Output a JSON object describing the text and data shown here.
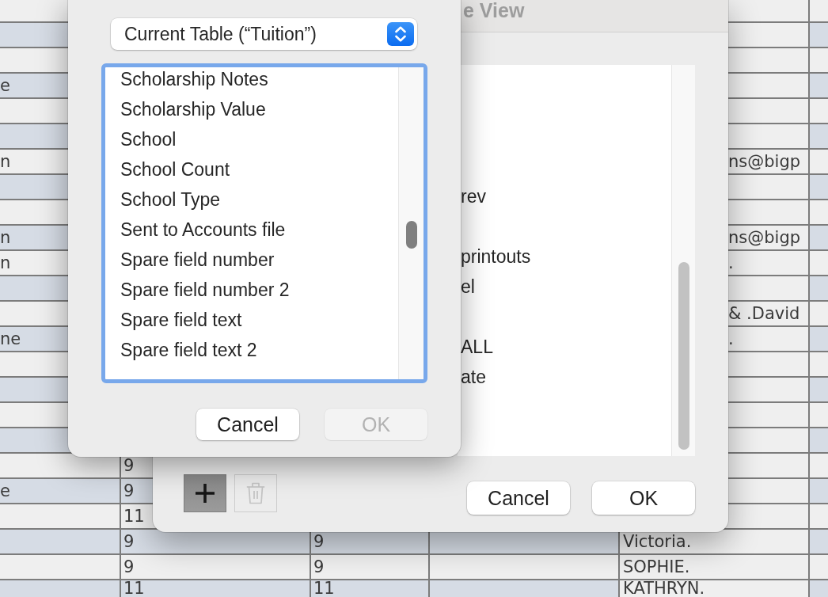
{
  "table": {
    "rows": [
      {
        "shaded": false
      },
      {
        "shaded": true
      },
      {
        "shaded": false
      },
      {
        "shaded": true,
        "column_1": "e"
      },
      {
        "shaded": false
      },
      {
        "shaded": true
      },
      {
        "shaded": false,
        "column_1": "n",
        "column_5": "ns@bigp"
      },
      {
        "shaded": true
      },
      {
        "shaded": false
      },
      {
        "shaded": true,
        "column_1": "n",
        "column_5": "ns@bigp"
      },
      {
        "shaded": false,
        "column_1": "n",
        "column_5": "."
      },
      {
        "shaded": true
      },
      {
        "shaded": false,
        "column_5": "& .David"
      },
      {
        "shaded": true,
        "column_1": "ne",
        "column_5": "."
      },
      {
        "shaded": false
      },
      {
        "shaded": true
      },
      {
        "shaded": false
      },
      {
        "shaded": true
      },
      {
        "shaded": false,
        "column_2": "9"
      },
      {
        "shaded": true,
        "column_1": "e",
        "column_2": "9"
      },
      {
        "shaded": false,
        "column_2": "11"
      },
      {
        "shaded": true,
        "column_2": "9",
        "column_3": "9",
        "column_5": "Victoria."
      },
      {
        "shaded": false,
        "column_2": "9",
        "column_3": "9",
        "column_5": "SOPHIE."
      },
      {
        "shaded": true,
        "column_2": "11",
        "column_3": "11",
        "column_5": "KATHRYN."
      }
    ]
  },
  "table_view_dialog": {
    "title": "e View",
    "list": {
      "items": [
        {
          "kind": "covered",
          "selected": false
        },
        {
          "kind": "covered",
          "selected": false
        },
        {
          "kind": "covered",
          "selected": false
        },
        {
          "kind": "covered",
          "selected": false
        },
        {
          "kind": "field",
          "label": "rev",
          "selected": false
        },
        {
          "kind": "covered",
          "selected": false
        },
        {
          "kind": "field",
          "label": "printouts",
          "selected": false
        },
        {
          "kind": "field",
          "label": "el",
          "selected": false
        },
        {
          "kind": "covered",
          "selected": false
        },
        {
          "kind": "field",
          "label": "ALL",
          "selected": false
        },
        {
          "kind": "field",
          "label": "ate",
          "selected": false
        }
      ]
    },
    "add_button": {
      "pressed": true
    },
    "delete_button": {
      "disabled": true
    },
    "buttons": [
      {
        "label": "Cancel",
        "disabled": false
      },
      {
        "label": "OK",
        "disabled": false
      }
    ]
  },
  "field_picker_sheet": {
    "table_popup": {
      "value": "Current Table (“Tuition”)"
    },
    "field_list": {
      "focused": true,
      "fields": [
        {
          "label": "Scholarship Notes",
          "selected": false
        },
        {
          "label": "Scholarship Value",
          "selected": false
        },
        {
          "label": "School",
          "selected": false
        },
        {
          "label": "School Count",
          "selected": false
        },
        {
          "label": "School Type",
          "selected": false
        },
        {
          "label": "Sent to Accounts file",
          "selected": false
        },
        {
          "label": "Spare field number",
          "selected": false
        },
        {
          "label": "Spare field number 2",
          "selected": false
        },
        {
          "label": "Spare field text",
          "selected": false
        },
        {
          "label": "Spare field text 2",
          "selected": false
        }
      ]
    },
    "buttons": [
      {
        "label": "Cancel",
        "disabled": false
      },
      {
        "label": "OK",
        "disabled": true
      }
    ]
  }
}
